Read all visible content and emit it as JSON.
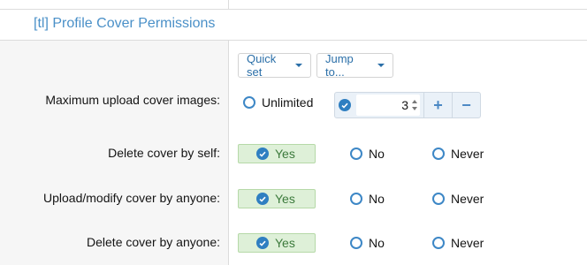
{
  "section_title": "[tl] Profile Cover Permissions",
  "toolbar": {
    "quick_set": "Quick set",
    "jump_to": "Jump to..."
  },
  "rows": [
    {
      "label": "Maximum upload cover images:",
      "options": {
        "unlimited": "Unlimited"
      },
      "number_value": "3",
      "plus_label": "+",
      "minus_label": "−"
    },
    {
      "label": "Delete cover by self:",
      "options": {
        "yes": "Yes",
        "no": "No",
        "never": "Never"
      },
      "selected": "yes"
    },
    {
      "label": "Upload/modify cover by anyone:",
      "options": {
        "yes": "Yes",
        "no": "No",
        "never": "Never"
      },
      "selected": "yes"
    },
    {
      "label": "Delete cover by anyone:",
      "options": {
        "yes": "Yes",
        "no": "No",
        "never": "Never"
      },
      "selected": "yes"
    }
  ],
  "colors": {
    "accent": "#4a90c8",
    "selected_bg": "#def0d8",
    "selected_text": "#3c7a3c"
  },
  "icons": {
    "selected": "check-circle-icon",
    "caret": "caret-down-icon"
  }
}
